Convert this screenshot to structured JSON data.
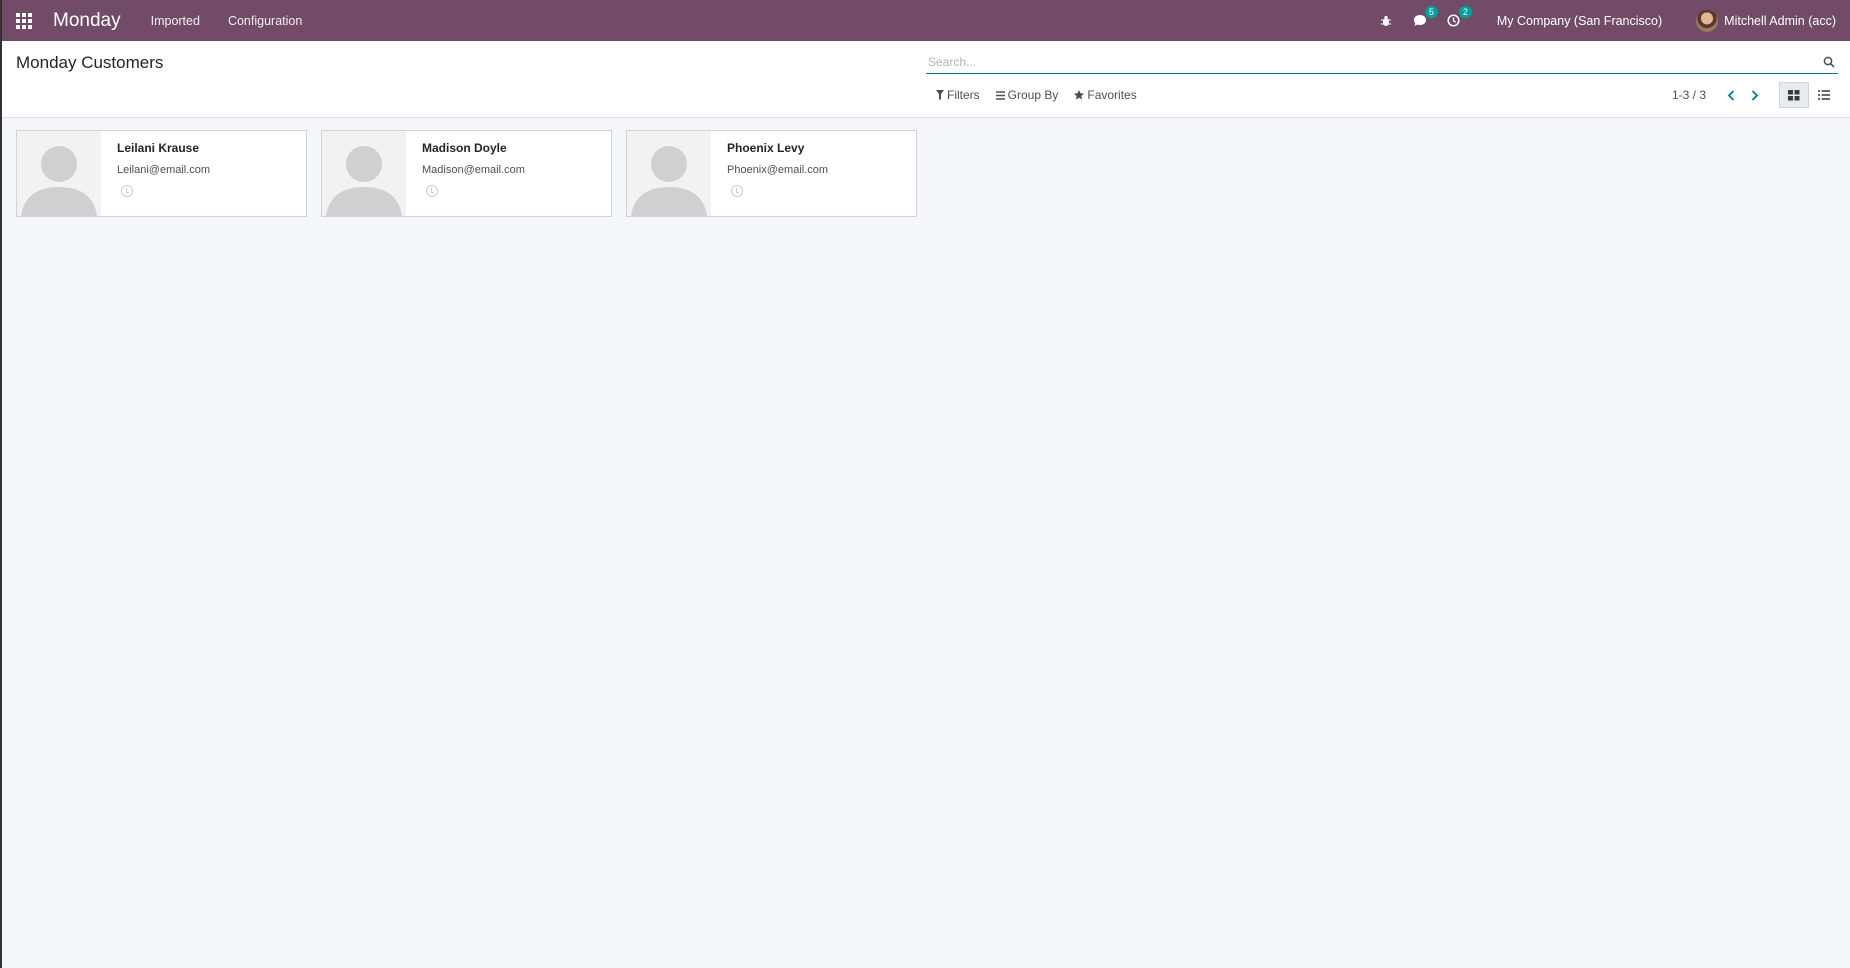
{
  "navbar": {
    "app_name": "Monday",
    "menu": [
      "Imported",
      "Configuration"
    ],
    "messages_count": "5",
    "activities_count": "2",
    "company": "My Company (San Francisco)",
    "user": "Mitchell Admin (acc)",
    "color": "#714b67"
  },
  "control_panel": {
    "title": "Monday Customers",
    "search_placeholder": "Search...",
    "filters_label": "Filters",
    "group_by_label": "Group By",
    "favorites_label": "Favorites",
    "pager": "1-3 / 3"
  },
  "customers": [
    {
      "name": "Leilani Krause",
      "email": "Leilani@email.com"
    },
    {
      "name": "Madison Doyle",
      "email": "Madison@email.com"
    },
    {
      "name": "Phoenix Levy",
      "email": "Phoenix@email.com"
    }
  ],
  "colors": {
    "accent": "#017e84",
    "badge": "#00a09d"
  }
}
